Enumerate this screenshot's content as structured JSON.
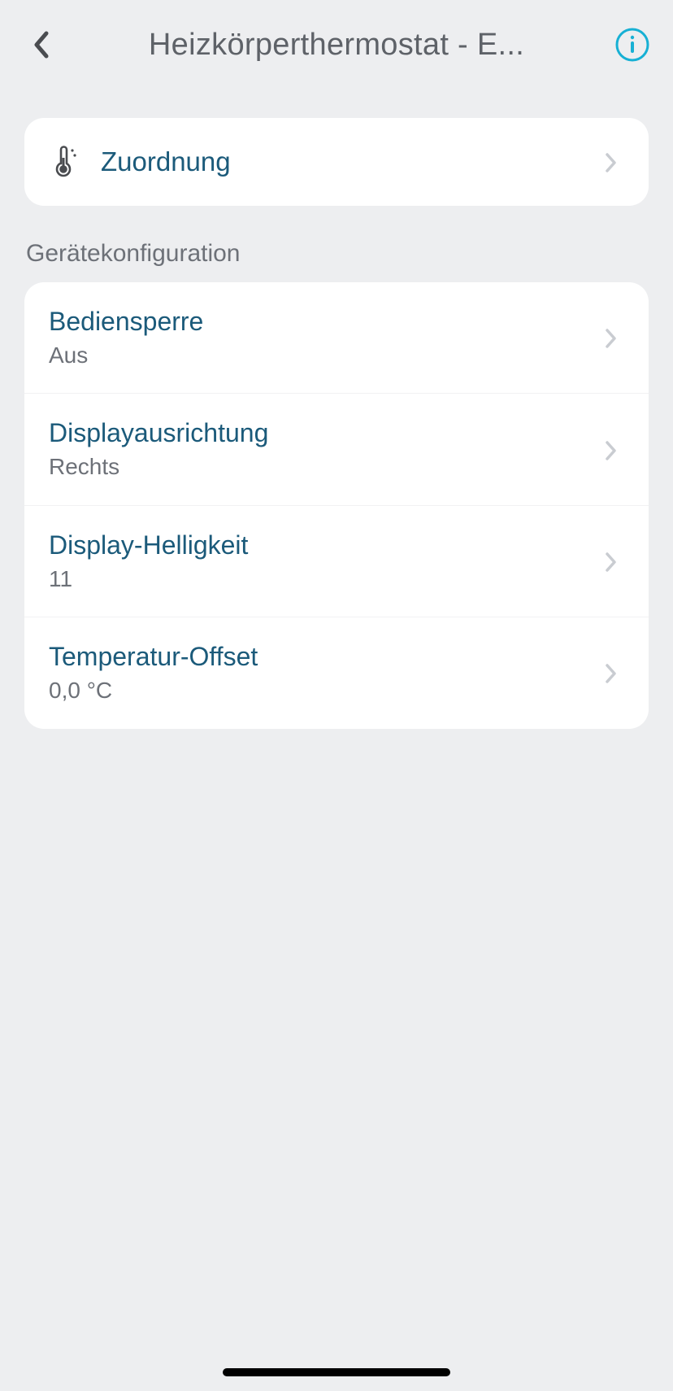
{
  "header": {
    "title": "Heizkörperthermostat - E..."
  },
  "assignment": {
    "label": "Zuordnung"
  },
  "section_header": "Gerätekonfiguration",
  "config": {
    "items": [
      {
        "label": "Bediensperre",
        "value": "Aus"
      },
      {
        "label": "Displayausrichtung",
        "value": "Rechts"
      },
      {
        "label": "Display-Helligkeit",
        "value": "11"
      },
      {
        "label": "Temperatur-Offset",
        "value": "0,0 °C"
      }
    ]
  }
}
